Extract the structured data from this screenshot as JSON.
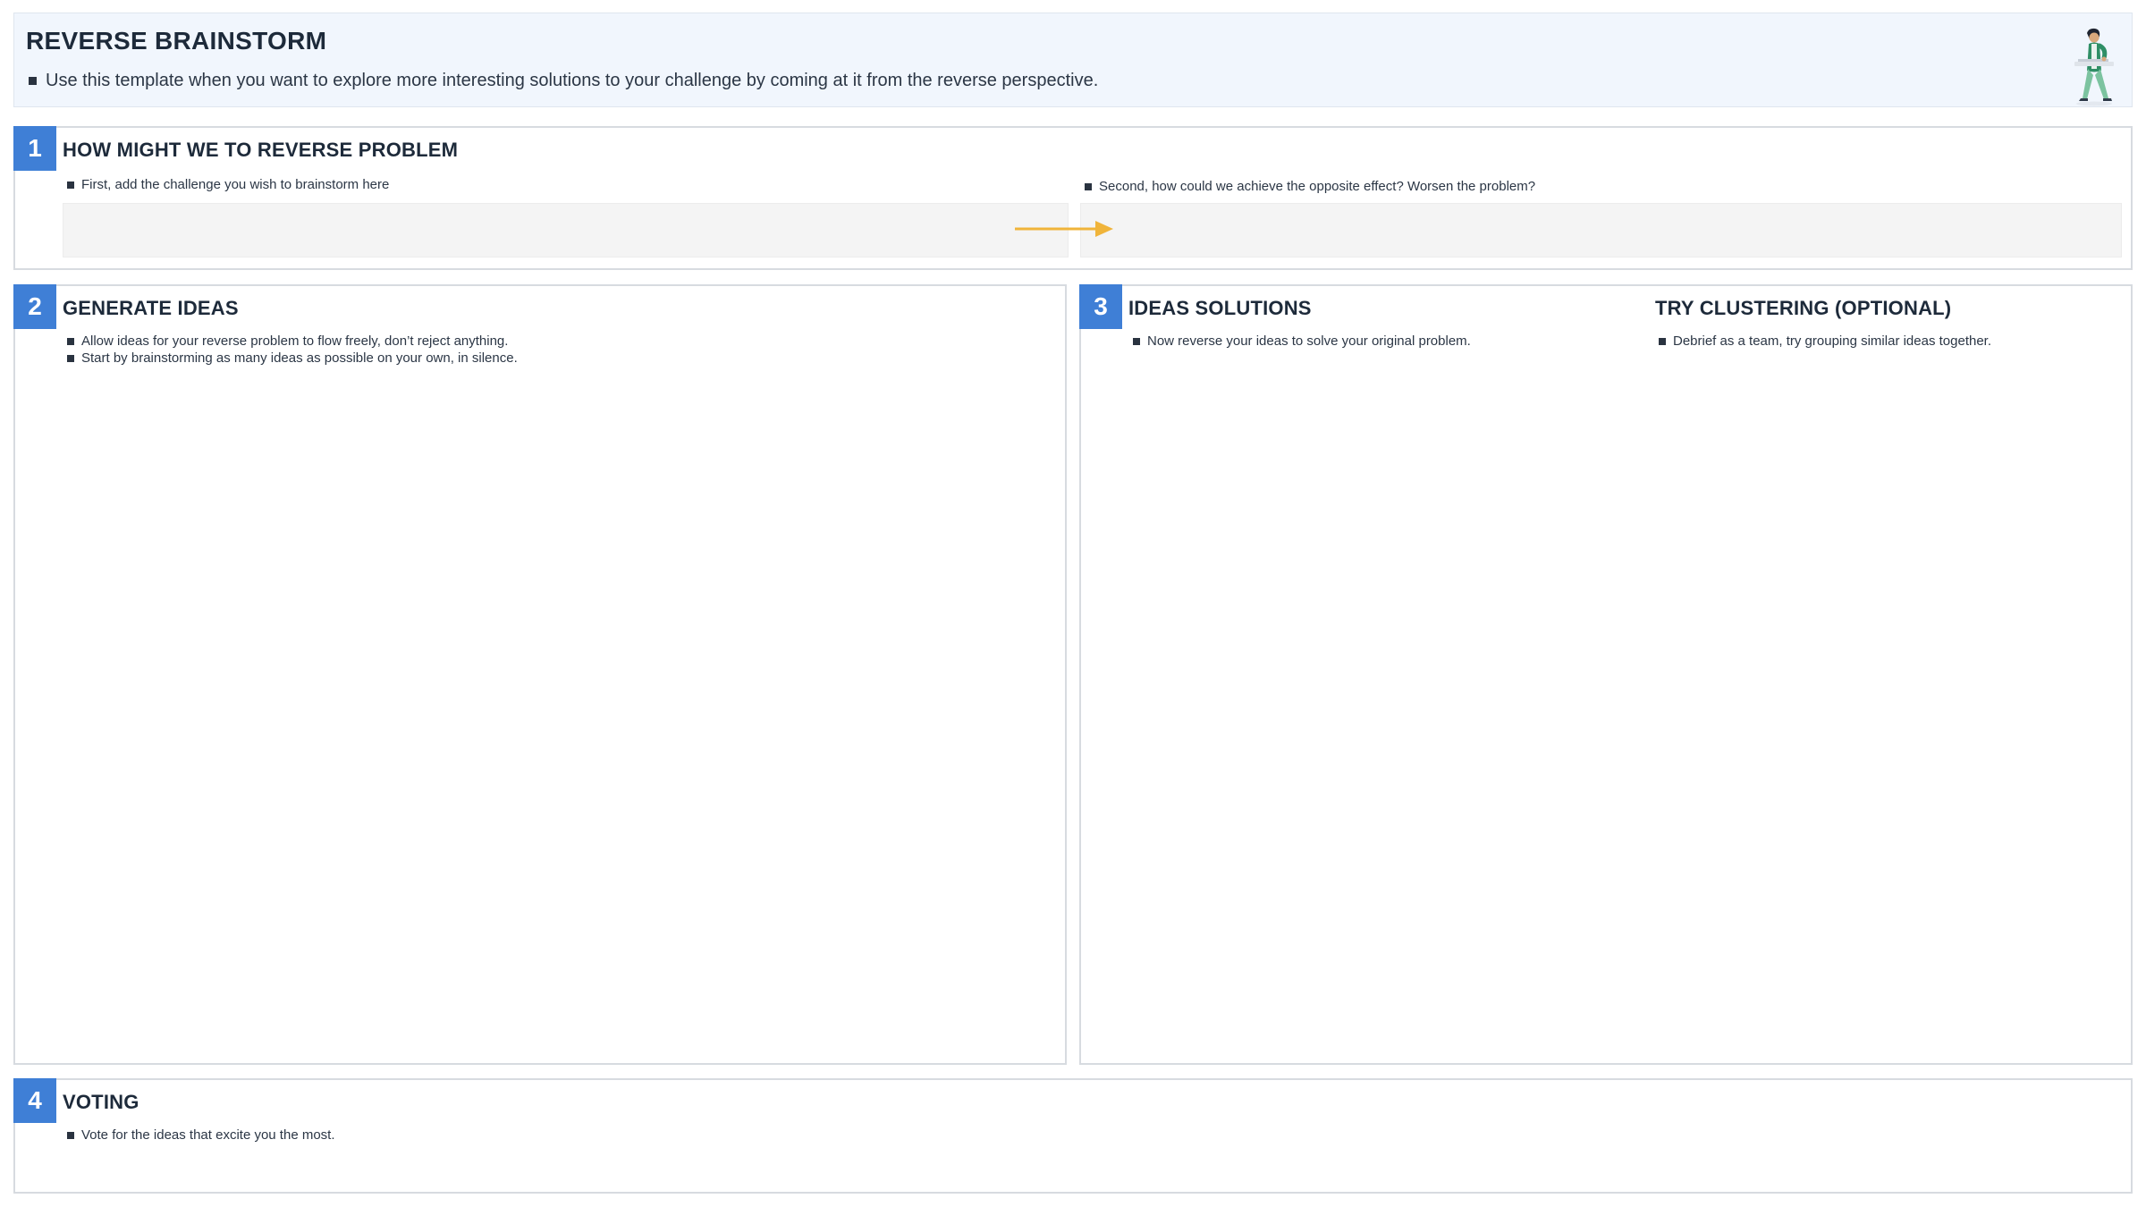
{
  "header": {
    "title": "REVERSE BRAINSTORM",
    "description": "Use this template when you want to explore more interesting solutions to your challenge by coming at it from the reverse perspective.",
    "figure_icon": "person-walking-with-laptop-illustration"
  },
  "sections": {
    "s1": {
      "number": "1",
      "title": "HOW MIGHT WE TO REVERSE PROBLEM",
      "left_instruction": "First, add the challenge you wish to brainstorm here",
      "right_instruction": "Second, how could we achieve the opposite effect? Worsen the problem?",
      "arrow_icon": "arrow-right-icon"
    },
    "s2": {
      "number": "2",
      "title": "GENERATE IDEAS",
      "instructions": [
        "Allow ideas for your reverse problem to flow freely, don’t reject anything.",
        "Start by brainstorming as many ideas as possible on your own, in silence."
      ]
    },
    "s3": {
      "number": "3",
      "title": "IDEAS SOLUTIONS",
      "instruction": "Now reverse your ideas to solve your original problem.",
      "cluster_title": "TRY CLUSTERING (OPTIONAL)",
      "cluster_instruction": "Debrief as a team, try grouping similar ideas together."
    },
    "s4": {
      "number": "4",
      "title": "VOTING",
      "instruction": "Vote for the ideas that excite you the most."
    }
  },
  "colors": {
    "accent": "#3f7fd6",
    "arrow": "#f0b43a",
    "header_bg": "#f1f6fd",
    "input_bg": "#f4f4f4",
    "border": "#d7dbe0"
  }
}
